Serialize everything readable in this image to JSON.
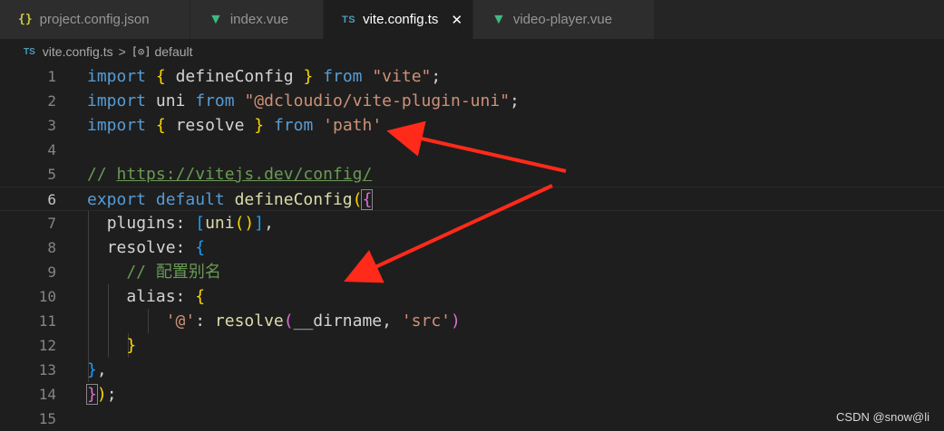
{
  "tabs": [
    {
      "label": "project.config.json",
      "icon": "json-icon",
      "icon_text": "{}",
      "active": false
    },
    {
      "label": "index.vue",
      "icon": "vue-icon",
      "icon_text": "V",
      "active": false
    },
    {
      "label": "vite.config.ts",
      "icon": "typescript-icon",
      "icon_text": "TS",
      "active": true
    },
    {
      "label": "video-player.vue",
      "icon": "vue-icon",
      "icon_text": "V",
      "active": false
    }
  ],
  "breadcrumb": {
    "file_icon_text": "TS",
    "file": "vite.config.ts",
    "separator": ">",
    "symbol_icon_text": "[⊙]",
    "symbol": "default"
  },
  "code": {
    "current_line": 6,
    "lines": [
      {
        "n": "1",
        "text": "import { defineConfig } from \"vite\";"
      },
      {
        "n": "2",
        "text": "import uni from \"@dcloudio/vite-plugin-uni\";"
      },
      {
        "n": "3",
        "text": "import { resolve } from 'path'"
      },
      {
        "n": "4",
        "text": ""
      },
      {
        "n": "5",
        "text": "// https://vitejs.dev/config/"
      },
      {
        "n": "6",
        "text": "export default defineConfig({"
      },
      {
        "n": "7",
        "text": "  plugins: [uni()],"
      },
      {
        "n": "8",
        "text": "  resolve: {"
      },
      {
        "n": "9",
        "text": "    // 配置别名"
      },
      {
        "n": "10",
        "text": "    alias: {"
      },
      {
        "n": "11",
        "text": "        '@': resolve(__dirname, 'src')"
      },
      {
        "n": "12",
        "text": "    }"
      },
      {
        "n": "13",
        "text": "},"
      },
      {
        "n": "14",
        "text": "});"
      },
      {
        "n": "15",
        "text": ""
      }
    ]
  },
  "watermark": "CSDN @snow@li",
  "colors": {
    "keyword": "#569cd6",
    "function": "#dcdcaa",
    "string": "#ce9178",
    "comment": "#6a9955",
    "annotation_arrow": "#ff2a1a"
  }
}
